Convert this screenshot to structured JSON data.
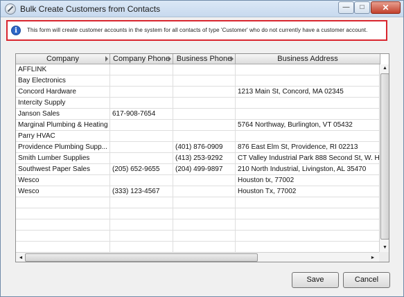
{
  "window": {
    "title": "Bulk Create Customers from Contacts",
    "controls": {
      "minimize": "—",
      "maximize": "□",
      "close": "✕"
    }
  },
  "info": {
    "icon": "info-icon",
    "message": "This form will create customer accounts in the system for all contacts of type 'Customer' who do not currently have a customer account."
  },
  "grid": {
    "columns": [
      "Company",
      "Company Phone",
      "Business Phone",
      "Business Address"
    ],
    "rows": [
      [
        "AFFLINK",
        "",
        "",
        ""
      ],
      [
        "Bay Electronics",
        "",
        "",
        ""
      ],
      [
        "Concord Hardware",
        "",
        "",
        "1213 Main St, Concord, MA 02345"
      ],
      [
        "Intercity Supply",
        "",
        "",
        ""
      ],
      [
        "Janson Sales",
        "617-908-7654",
        "",
        ""
      ],
      [
        "Marginal Plumbing & Heating",
        "",
        "",
        "5764 Northway, Burlington, VT 05432"
      ],
      [
        "Parry HVAC",
        "",
        "",
        ""
      ],
      [
        "Providence Plumbing Supp...",
        "",
        "(401) 876-0909",
        "876 East Elm St, Providence, RI 02213"
      ],
      [
        "Smith Lumber Supplies",
        "",
        "(413) 253-9292",
        "CT Valley Industrial Park 888 Second St, W. H"
      ],
      [
        "Southwest Paper Sales",
        "(205) 652-9655",
        "(204) 499-9897",
        "210 North Industrial, Livingston, AL 35470"
      ],
      [
        "Wesco",
        "",
        "",
        "Houston tx, 77002"
      ],
      [
        "Wesco",
        "(333) 123-4567",
        "",
        "Houston Tx, 77002"
      ],
      [
        "",
        "",
        "",
        ""
      ],
      [
        "",
        "",
        "",
        ""
      ],
      [
        "",
        "",
        "",
        ""
      ],
      [
        "",
        "",
        "",
        ""
      ],
      [
        "",
        "",
        "",
        ""
      ]
    ]
  },
  "scrollbars": {
    "up": "▲",
    "down": "▼",
    "left": "◄",
    "right": "►"
  },
  "buttons": {
    "save": "Save",
    "cancel": "Cancel"
  }
}
